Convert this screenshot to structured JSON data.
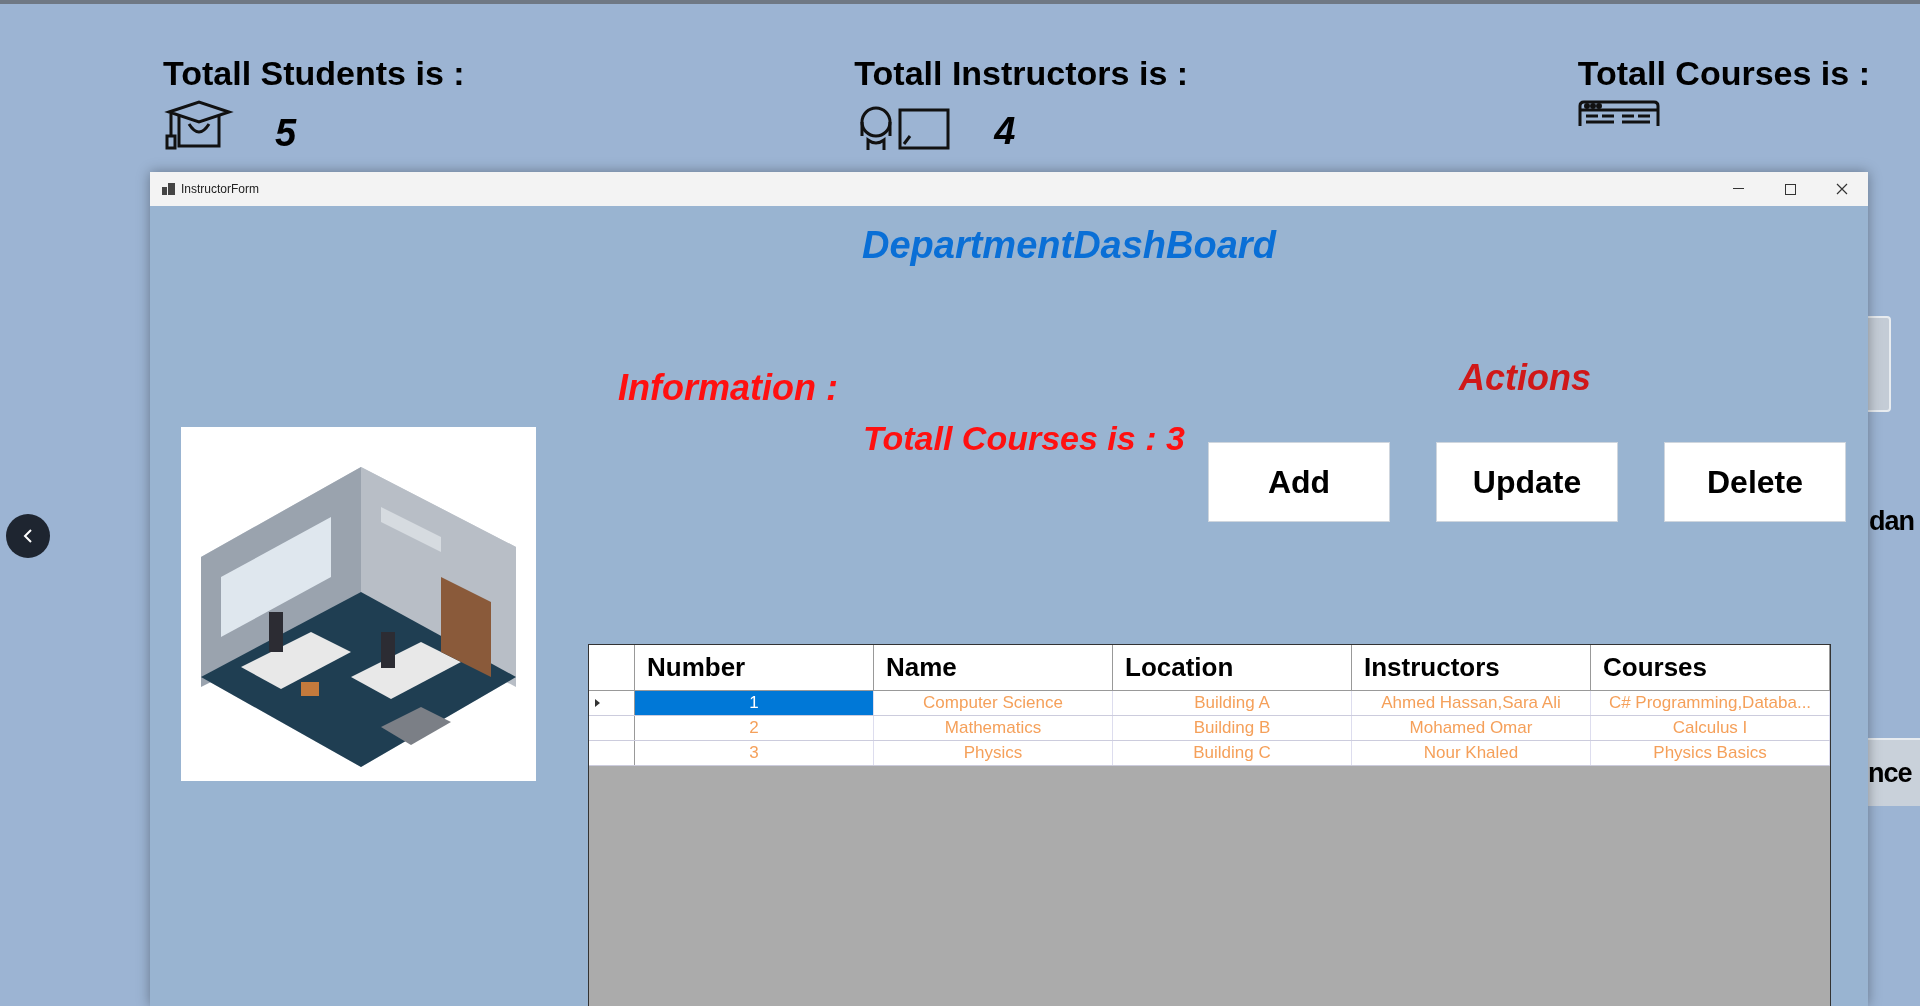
{
  "background": {
    "stats": [
      {
        "label": "Totall Students is :",
        "value": "5"
      },
      {
        "label": "Totall Instructors is :",
        "value": "4"
      },
      {
        "label": "Totall Courses is :"
      }
    ],
    "fragments": [
      "dan",
      "nce"
    ]
  },
  "window": {
    "title": "InstructorForm",
    "heading": "DepartmentDashBoard",
    "info_label": "Information :",
    "actions_label": "Actions",
    "courses_total": "Totall Courses is : 3",
    "buttons": [
      "Add",
      "Update",
      "Delete"
    ],
    "table": {
      "columns": [
        "Number",
        "Name",
        "Location",
        "Instructors",
        "Courses"
      ],
      "rows": [
        {
          "selected": true,
          "cells": [
            "1",
            "Computer Science",
            "Building A",
            "Ahmed Hassan,Sara Ali",
            "C# Programming,Databa..."
          ]
        },
        {
          "selected": false,
          "cells": [
            "2",
            "Mathematics",
            "Building B",
            "Mohamed Omar",
            "Calculus I"
          ]
        },
        {
          "selected": false,
          "cells": [
            "3",
            "Physics",
            "Building C",
            "Nour Khaled",
            "Physics Basics"
          ]
        }
      ]
    }
  }
}
